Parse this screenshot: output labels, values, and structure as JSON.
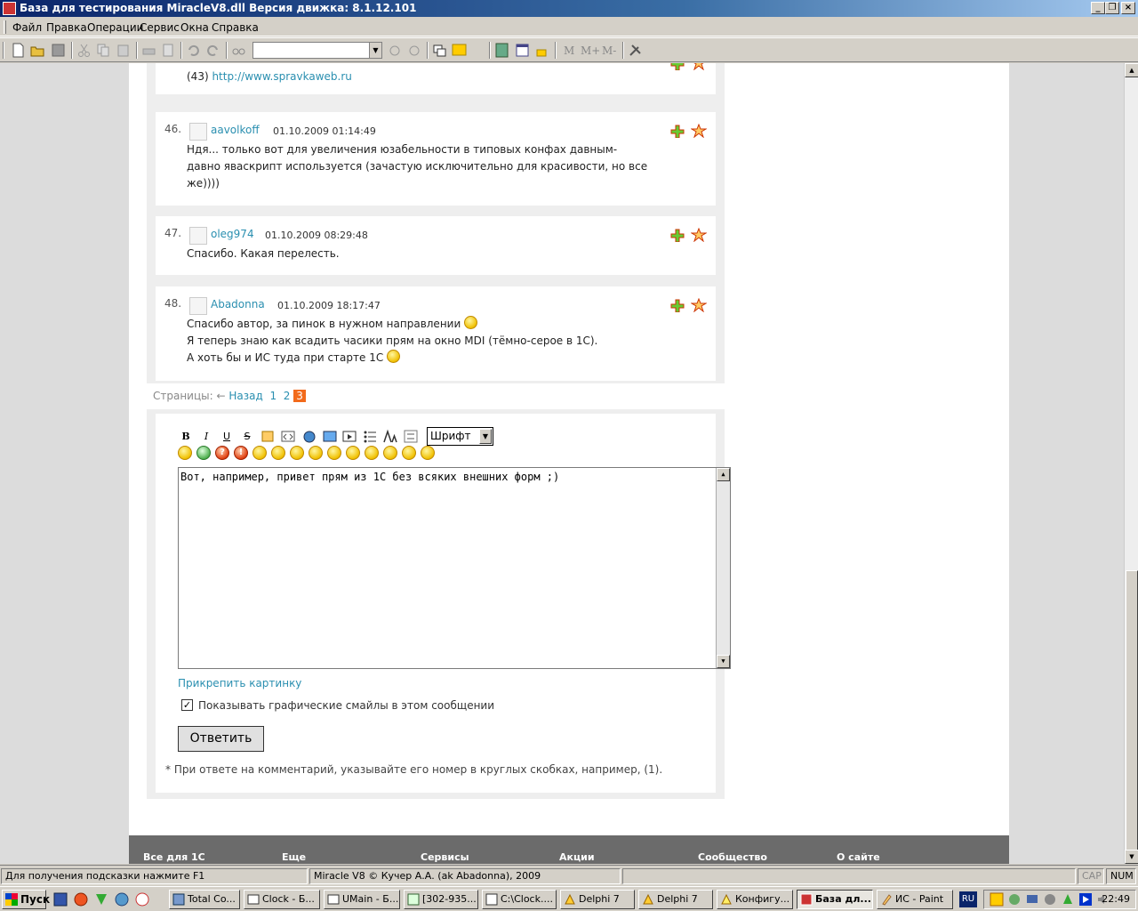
{
  "window": {
    "title": "База для тестирования MiracleV8.dll  Версия движка: 8.1.12.101",
    "buttons": {
      "minimize": "_",
      "restore": "❐",
      "close": "×"
    }
  },
  "menu": {
    "items": [
      "Файл",
      "Правка",
      "Операции",
      "Сервис",
      "Окна",
      "Справка"
    ]
  },
  "toolbar": {
    "text_buttons": [
      "M",
      "M+",
      "M-"
    ]
  },
  "comments": [
    {
      "tail_text": "(43) ",
      "tail_link": "http://www.spravkaweb.ru"
    },
    {
      "number": "46.",
      "author": "aavolkoff",
      "date": "01.10.2009 01:14:49",
      "lines": [
        "Ндя... только вот для увеличения юзабельности в типовых конфах давным-",
        "давно яваскрипт используется (зачастую исключительно для красивости, но все",
        "же))))"
      ]
    },
    {
      "number": "47.",
      "author": "oleg974",
      "date": "01.10.2009 08:29:48",
      "lines": [
        "Спасибо. Какая перелесть."
      ]
    },
    {
      "number": "48.",
      "author": "Abadonna",
      "date": "01.10.2009 18:17:47",
      "lines": [
        "Спасибо автор, за пинок в нужном направлении ",
        "Я теперь знаю как всадить часики прям на окно MDI (тёмно-серое в 1С).",
        "А хоть бы и ИС туда при старте 1С "
      ]
    }
  ],
  "pager": {
    "label": "Страницы:",
    "arrow": "←",
    "back": "Назад",
    "pages": [
      "1",
      "2"
    ],
    "current": "3"
  },
  "editor": {
    "format_buttons": {
      "bold": "B",
      "italic": "I",
      "underline": "U",
      "strike": "S"
    },
    "font_select": "Шрифт",
    "emoji_marks": {
      "question": "?",
      "exclaim": "!"
    },
    "text": "Вот, например, привет прям из 1С без всяких внешних форм ;)",
    "attach_link": "Прикрепить картинку",
    "checkbox_label": "Показывать графические смайлы в этом сообщении",
    "checkbox_checked": true,
    "reply_button": "Ответить",
    "note": "* При ответе на комментарий, указывайте его номер в круглых скобках, например, (1)."
  },
  "footer": {
    "columns": [
      "Все для 1С",
      "Еще",
      "Сервисы",
      "Акции",
      "Сообщество",
      "О сайте"
    ]
  },
  "statusbar": {
    "hint": "Для получения подсказки нажмите F1",
    "copyright": "Miracle V8 © Кучер А.А. (ak Abadonna), 2009",
    "cap": "CAP",
    "num": "NUM"
  },
  "taskbar": {
    "start": "Пуск",
    "tasks": [
      "Total Co...",
      "Clock - Б...",
      "UMain - Б...",
      "[302-935...",
      "C:\\Clock....",
      "Delphi 7",
      "Delphi 7",
      "Конфигу...",
      "База дл...",
      "ИС - Paint"
    ],
    "active_task_index": 8,
    "language": "RU",
    "clock": "22:49"
  },
  "colors": {
    "link": "#2a8fb0",
    "current_page": "#f26a1b",
    "footer": "#6b6b6b",
    "titlebar": "#0a246a"
  }
}
